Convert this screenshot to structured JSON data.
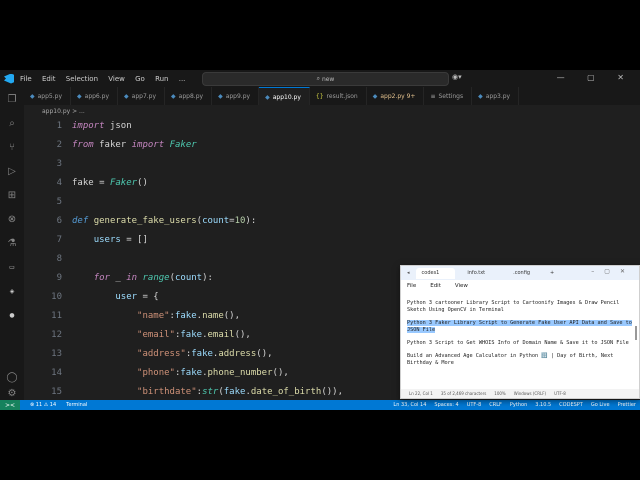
{
  "titlebar": {
    "menu": [
      "File",
      "Edit",
      "Selection",
      "View",
      "Go",
      "Run",
      "..."
    ],
    "search": "new",
    "window_controls": "— ▢ ✕"
  },
  "activity_bar": {
    "icons": [
      "explorer-icon",
      "search-icon",
      "source-control-icon",
      "run-debug-icon",
      "extensions-icon",
      "test-icon",
      "testing-icon",
      "database-icon",
      "python-icon",
      "docker-icon",
      "account-icon",
      "settings-gear-icon"
    ]
  },
  "tabs": [
    {
      "label": "app5.py"
    },
    {
      "label": "app6.py"
    },
    {
      "label": "app7.py"
    },
    {
      "label": "app8.py"
    },
    {
      "label": "app9.py"
    },
    {
      "label": "app10.py",
      "active": true
    },
    {
      "label": "result.json"
    },
    {
      "label": "app2.py 9+"
    },
    {
      "label": "Settings"
    },
    {
      "label": "app3.py"
    }
  ],
  "breadcrumb": "app10.py > ...",
  "code": {
    "line_numbers": [
      "1",
      "2",
      "3",
      "4",
      "5",
      "6",
      "7",
      "8",
      "9",
      "10",
      "11",
      "12",
      "13",
      "14",
      "15"
    ]
  },
  "statusbar": {
    "remote": "><",
    "problems": "⊗ 11 ⚠ 14",
    "terminal": "Terminal",
    "position": "Ln 33, Col 14",
    "spaces": "Spaces: 4",
    "encoding": "UTF-8",
    "eol": "CRLF",
    "language": "Python",
    "version": "3.10.5",
    "codesnap": "CODESPT",
    "go_live": "Go Live",
    "prettier": "Prettier"
  },
  "notepad": {
    "tabs": [
      "codes1",
      "info.txt",
      ".config"
    ],
    "menu": [
      "File",
      "Edit",
      "View"
    ],
    "paragraphs": [
      "Python 3 cartooner Library Script to Cartoonify Images & Draw Pencil Sketch Using OpenCV in Terminal",
      "Python 3 Faker Library Script to Generate Fake User API Data and Save to JSON File",
      "Python 3 Script to Get WHOIS Info of Domain Name & Save it to JSON File",
      "Build an Advanced Age Calculator in Python 🔢 | Day of Birth, Next Birthday & More"
    ],
    "status": {
      "position": "Ln 22, Col 1",
      "chars": "35 of 2,469 characters",
      "zoom": "100%",
      "eol": "Windows (CRLF)",
      "encoding": "UTF-8"
    }
  }
}
